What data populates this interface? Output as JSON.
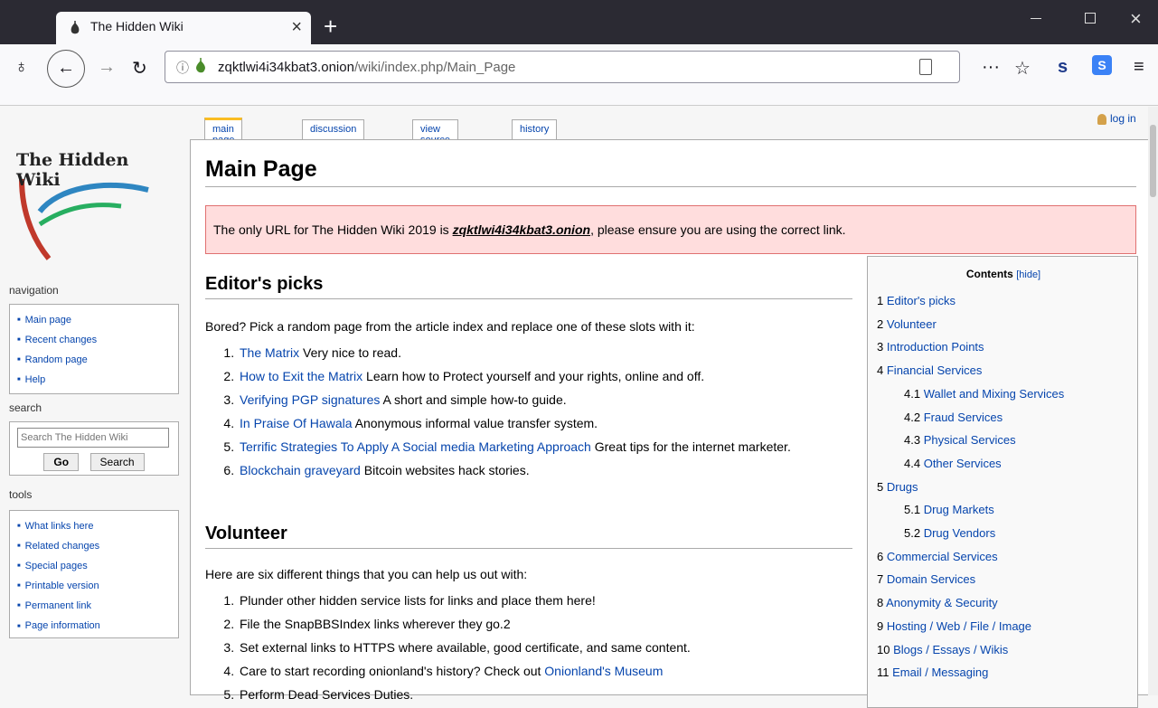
{
  "browser": {
    "tab_title": "The Hidden Wiki",
    "url_host": "zqktlwi4i34kbat3.onion",
    "url_path": "/wiki/index.php/Main_Page",
    "icons": [
      "tor-onion-icon",
      "back-icon",
      "forward-icon",
      "reload-icon",
      "info-icon",
      "reader-view-icon",
      "more-icon",
      "star-icon",
      "menu-icon"
    ]
  },
  "page": {
    "login": "log in",
    "logo_text": "The Hidden Wiki",
    "tabs": {
      "main": "main page",
      "discussion": "discussion",
      "source": "view source",
      "history": "history"
    },
    "title": "Main Page",
    "notice": {
      "pre": "The only URL for The Hidden Wiki 2019 is ",
      "link": "zqktlwi4i34kbat3.onion",
      "post": ", please ensure you are using the correct link."
    }
  },
  "sidebar": {
    "navigation": {
      "heading": "navigation",
      "items": [
        "Main page",
        "Recent changes",
        "Random page",
        "Help"
      ]
    },
    "search": {
      "heading": "search",
      "placeholder": "Search The Hidden Wiki",
      "go": "Go",
      "search": "Search"
    },
    "tools": {
      "heading": "tools",
      "items": [
        "What links here",
        "Related changes",
        "Special pages",
        "Printable version",
        "Permanent link",
        "Page information"
      ]
    }
  },
  "editors": {
    "heading": "Editor's picks",
    "intro": "Bored? Pick a random page from the article index and replace one of these slots with it:",
    "items": [
      {
        "link": "The Matrix",
        "text": " Very nice to read."
      },
      {
        "link": "How to Exit the Matrix",
        "text": " Learn how to Protect yourself and your rights, online and off."
      },
      {
        "link": "Verifying PGP signatures",
        "text": " A short and simple how-to guide."
      },
      {
        "link": "In Praise Of Hawala",
        "text": " Anonymous informal value transfer system."
      },
      {
        "link": "Terrific Strategies To Apply A Social media Marketing Approach",
        "text": " Great tips for the internet marketer."
      },
      {
        "link": "Blockchain graveyard",
        "text": " Bitcoin websites hack stories."
      }
    ]
  },
  "volunteer": {
    "heading": "Volunteer",
    "intro": "Here are six different things that you can help us out with:",
    "items": [
      {
        "text": "Plunder other hidden service lists for links and place them here!",
        "link": ""
      },
      {
        "text": "File the SnapBBSIndex links wherever they go.2",
        "link": ""
      },
      {
        "text": "Set external links to HTTPS where available, good certificate, and same content.",
        "link": ""
      },
      {
        "text": "Care to start recording onionland's history? Check out ",
        "link": "Onionland's Museum"
      },
      {
        "text": "Perform Dead Services Duties.",
        "link": ""
      }
    ]
  },
  "toc": {
    "title": "Contents",
    "hide": "[hide]",
    "items": [
      {
        "num": "1",
        "label": "Editor's picks",
        "sub": false
      },
      {
        "num": "2",
        "label": "Volunteer",
        "sub": false
      },
      {
        "num": "3",
        "label": "Introduction Points",
        "sub": false
      },
      {
        "num": "4",
        "label": "Financial Services",
        "sub": false
      },
      {
        "num": "4.1",
        "label": "Wallet and Mixing Services",
        "sub": true
      },
      {
        "num": "4.2",
        "label": "Fraud Services",
        "sub": true
      },
      {
        "num": "4.3",
        "label": "Physical Services",
        "sub": true
      },
      {
        "num": "4.4",
        "label": "Other Services",
        "sub": true
      },
      {
        "num": "5",
        "label": "Drugs",
        "sub": false
      },
      {
        "num": "5.1",
        "label": "Drug Markets",
        "sub": true
      },
      {
        "num": "5.2",
        "label": "Drug Vendors",
        "sub": true
      },
      {
        "num": "6",
        "label": "Commercial Services",
        "sub": false
      },
      {
        "num": "7",
        "label": "Domain Services",
        "sub": false
      },
      {
        "num": "8",
        "label": "Anonymity & Security",
        "sub": false
      },
      {
        "num": "9",
        "label": "Hosting / Web / File / Image",
        "sub": false
      },
      {
        "num": "10",
        "label": "Blogs / Essays / Wikis",
        "sub": false
      },
      {
        "num": "11",
        "label": "Email / Messaging",
        "sub": false
      }
    ]
  },
  "colors": {
    "link": "#0645ad",
    "notice_bg": "#ffdddd",
    "tab_accent": "#fabd23"
  }
}
